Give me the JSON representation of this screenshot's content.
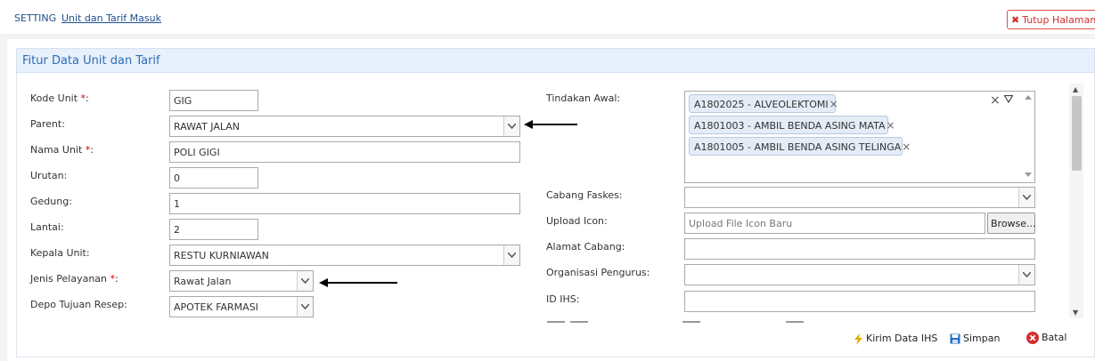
{
  "breadcrumb": {
    "root": "SETTING",
    "current": "Unit dan Tarif Masuk"
  },
  "close_page": {
    "icon": "close-icon",
    "label": "Tutup Halaman"
  },
  "panel": {
    "title": "Fitur Data Unit dan Tarif"
  },
  "left_form": {
    "kode_unit": {
      "label": "Kode Unit ",
      "required": "*",
      "colon": ":",
      "value": "GIG"
    },
    "parent": {
      "label": "Parent:",
      "value": "RAWAT JALAN"
    },
    "nama_unit": {
      "label": "Nama Unit ",
      "required": "*",
      "colon": ":",
      "value": "POLI GIGI"
    },
    "urutan": {
      "label": "Urutan:",
      "value": "0"
    },
    "gedung": {
      "label": "Gedung:",
      "value": "1"
    },
    "lantai": {
      "label": "Lantai:",
      "value": "2"
    },
    "kepala_unit": {
      "label": "Kepala Unit:",
      "value": "RESTU KURNIAWAN"
    },
    "jenis_pelayanan": {
      "label": "Jenis Pelayanan ",
      "required": "*",
      "colon": ":",
      "value": "Rawat Jalan"
    },
    "depo_tujuan_resep": {
      "label": "Depo Tujuan Resep:",
      "value": "APOTEK FARMASI"
    }
  },
  "right_form": {
    "tindakan_awal": {
      "label": "Tindakan Awal:",
      "tags": [
        "A1802025 - ALVEOLEKTOMI",
        "A1801003 - AMBIL BENDA ASING MATA",
        "A1801005 - AMBIL BENDA ASING TELINGA"
      ],
      "tag_remove": "×",
      "clear": "×"
    },
    "cabang_faskes": {
      "label": "Cabang Faskes:",
      "value": ""
    },
    "upload_icon": {
      "label": "Upload Icon:",
      "placeholder": "Upload File Icon Baru",
      "browse": "Browse..."
    },
    "alamat_cabang": {
      "label": "Alamat Cabang:",
      "value": ""
    },
    "organisasi_pengurus": {
      "label": "Organisasi Pengurus:",
      "value": ""
    },
    "id_ihs": {
      "label": "ID IHS:",
      "value": ""
    }
  },
  "actions": {
    "kirim": {
      "label": "Kirim Data IHS",
      "icon": "lightning-icon",
      "color": "#e0a800"
    },
    "simpan": {
      "label": "Simpan",
      "icon": "save-icon",
      "color": "#1f6fc4"
    },
    "batal": {
      "label": "Batal",
      "icon": "cancel-icon",
      "color": "#d32f2f"
    }
  }
}
